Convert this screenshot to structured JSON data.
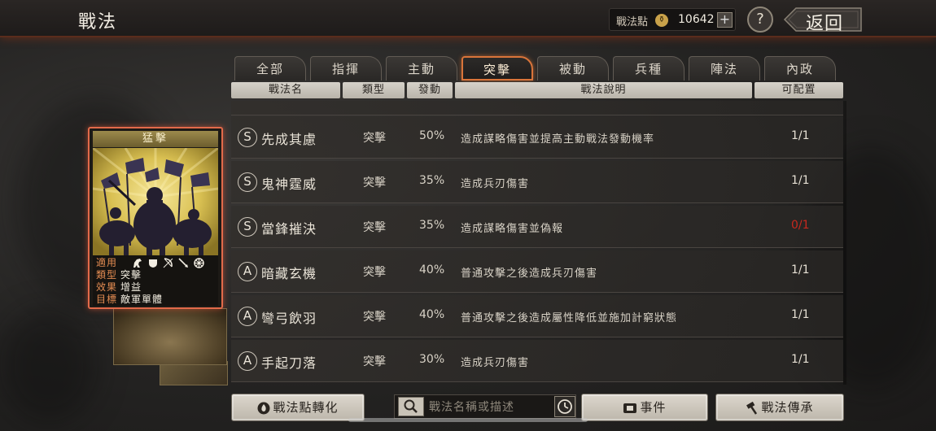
{
  "header": {
    "title": "戰法",
    "points_label": "戰法點",
    "points_value": "10642",
    "plus": "+",
    "help": "?",
    "back_label": "返回"
  },
  "tabs": [
    {
      "label": "全部",
      "active": false
    },
    {
      "label": "指揮",
      "active": false
    },
    {
      "label": "主動",
      "active": false
    },
    {
      "label": "突擊",
      "active": true
    },
    {
      "label": "被動",
      "active": false
    },
    {
      "label": "兵種",
      "active": false
    },
    {
      "label": "陣法",
      "active": false
    },
    {
      "label": "內政",
      "active": false
    }
  ],
  "columns": {
    "name": "戰法名",
    "type": "類型",
    "rate": "發動",
    "desc": "戰法說明",
    "slots": "可配置"
  },
  "rows": [
    {
      "grade": "S",
      "name": "先成其慮",
      "type": "突擊",
      "rate": "50%",
      "desc": "造成謀略傷害並提高主動戰法發動機率",
      "slots": "1/1",
      "slots_color": "#e6e0d4"
    },
    {
      "grade": "S",
      "name": "鬼神霆威",
      "type": "突擊",
      "rate": "35%",
      "desc": "造成兵刃傷害",
      "slots": "1/1",
      "slots_color": "#e6e0d4"
    },
    {
      "grade": "S",
      "name": "當鋒摧決",
      "type": "突擊",
      "rate": "35%",
      "desc": "造成謀略傷害並偽報",
      "slots": "0/1",
      "slots_color": "#c7281e"
    },
    {
      "grade": "A",
      "name": "暗藏玄機",
      "type": "突擊",
      "rate": "40%",
      "desc": "普通攻擊之後造成兵刃傷害",
      "slots": "1/1",
      "slots_color": "#e6e0d4"
    },
    {
      "grade": "A",
      "name": "彎弓飲羽",
      "type": "突擊",
      "rate": "40%",
      "desc": "普通攻擊之後造成屬性降低並施加計窮狀態",
      "slots": "1/1",
      "slots_color": "#e6e0d4"
    },
    {
      "grade": "A",
      "name": "手起刀落",
      "type": "突擊",
      "rate": "30%",
      "desc": "造成兵刃傷害",
      "slots": "1/1",
      "slots_color": "#e6e0d4"
    }
  ],
  "card": {
    "title": "猛擊",
    "applies_label": "適用",
    "applies_icons": [
      "cavalry-icon",
      "shield-icon",
      "bow-icon",
      "spear-icon",
      "wheel-icon"
    ],
    "type_label": "類型",
    "type_value": "突擊",
    "effect_label": "效果",
    "effect_value": "增益",
    "target_label": "目標",
    "target_value": "敵軍單體"
  },
  "footer": {
    "convert_label": "戰法點轉化",
    "search_placeholder": "戰法名稱或描述",
    "events_label": "事件",
    "inherit_label": "戰法傳承"
  },
  "colors": {
    "accent": "#d9743a",
    "card_border": "#e26a4a",
    "unavailable": "#c7281e"
  }
}
